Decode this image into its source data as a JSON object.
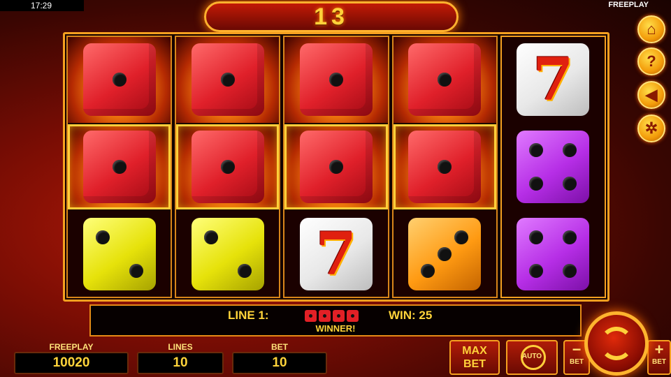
{
  "status": {
    "time": "17:29",
    "mode": "FREEPLAY"
  },
  "counter": "13",
  "reels": [
    [
      {
        "kind": "red",
        "pips": 1,
        "fire": true,
        "framed": false
      },
      {
        "kind": "red",
        "pips": 1,
        "fire": true,
        "framed": true
      },
      {
        "kind": "yellow",
        "pips": 2,
        "fire": false,
        "framed": false
      }
    ],
    [
      {
        "kind": "red",
        "pips": 1,
        "fire": true,
        "framed": false
      },
      {
        "kind": "red",
        "pips": 1,
        "fire": true,
        "framed": true
      },
      {
        "kind": "yellow",
        "pips": 2,
        "fire": false,
        "framed": false
      }
    ],
    [
      {
        "kind": "red",
        "pips": 1,
        "fire": true,
        "framed": false
      },
      {
        "kind": "red",
        "pips": 1,
        "fire": true,
        "framed": true
      },
      {
        "kind": "seven",
        "pips": 0,
        "fire": false,
        "framed": false
      }
    ],
    [
      {
        "kind": "red",
        "pips": 1,
        "fire": true,
        "framed": false
      },
      {
        "kind": "red",
        "pips": 1,
        "fire": true,
        "framed": true
      },
      {
        "kind": "orange",
        "pips": 3,
        "fire": false,
        "framed": false
      }
    ],
    [
      {
        "kind": "seven",
        "pips": 0,
        "fire": false,
        "framed": false
      },
      {
        "kind": "purple",
        "pips": 4,
        "fire": false,
        "framed": false
      },
      {
        "kind": "purple",
        "pips": 4,
        "fire": false,
        "framed": false
      }
    ]
  ],
  "seven_label": "7",
  "info": {
    "line_label": "LINE 1:",
    "line_dice_count": 4,
    "win_label": "WIN: 25",
    "winner_label": "WINNER!"
  },
  "stats": {
    "freeplay_title": "FREEPLAY",
    "freeplay_value": "10020",
    "lines_title": "LINES",
    "lines_value": "10",
    "bet_title": "BET",
    "bet_value": "10"
  },
  "buttons": {
    "max_line1": "MAX",
    "max_line2": "BET",
    "auto": "AUTO",
    "minus_sign": "−",
    "minus_label": "BET",
    "plus_sign": "+",
    "plus_label": "BET"
  },
  "side_icons": [
    "home-icon",
    "help-icon",
    "sound-off-icon",
    "gear-icon"
  ],
  "side_glyphs": {
    "home": "⌂",
    "help": "?",
    "sound": "◀",
    "gear": "✲"
  },
  "colors": {
    "gold": "#ffd43a",
    "frame": "#f5a020",
    "red_die": "#e0202a",
    "yellow_die": "#e6e20a",
    "orange_die": "#ff9a12",
    "purple_die": "#b62ee6"
  }
}
